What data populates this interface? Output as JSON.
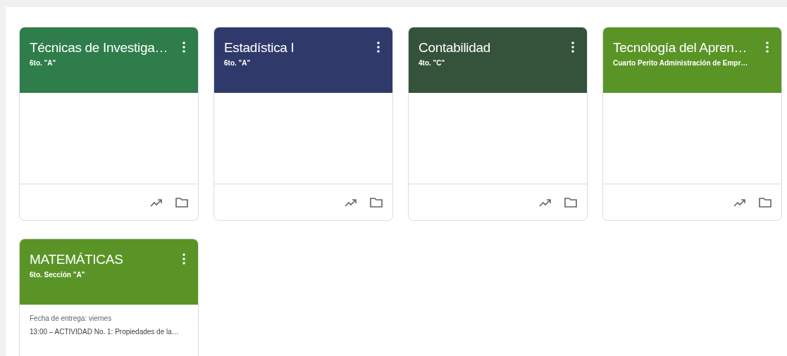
{
  "courses": [
    {
      "title": "Técnicas de Investiga…",
      "section": "6to. \"A\"",
      "color": "#2e7d4a"
    },
    {
      "title": "Estadística I",
      "section": "6to. \"A\"",
      "color": "#2f3a6a"
    },
    {
      "title": "Contabilidad",
      "section": "4to. \"C\"",
      "color": "#35523b"
    },
    {
      "title": "Tecnología del Apren…",
      "section": "Cuarto Perito Administración de Empr…",
      "color": "#5b9426"
    },
    {
      "title": "MATEMÁTICAS",
      "section": "6to. Sección \"A\"",
      "color": "#5b9426",
      "due": "Fecha de entrega: viernes",
      "assignment": "13:00 – ACTIVIDAD No. 1: Propiedades de la…"
    }
  ]
}
